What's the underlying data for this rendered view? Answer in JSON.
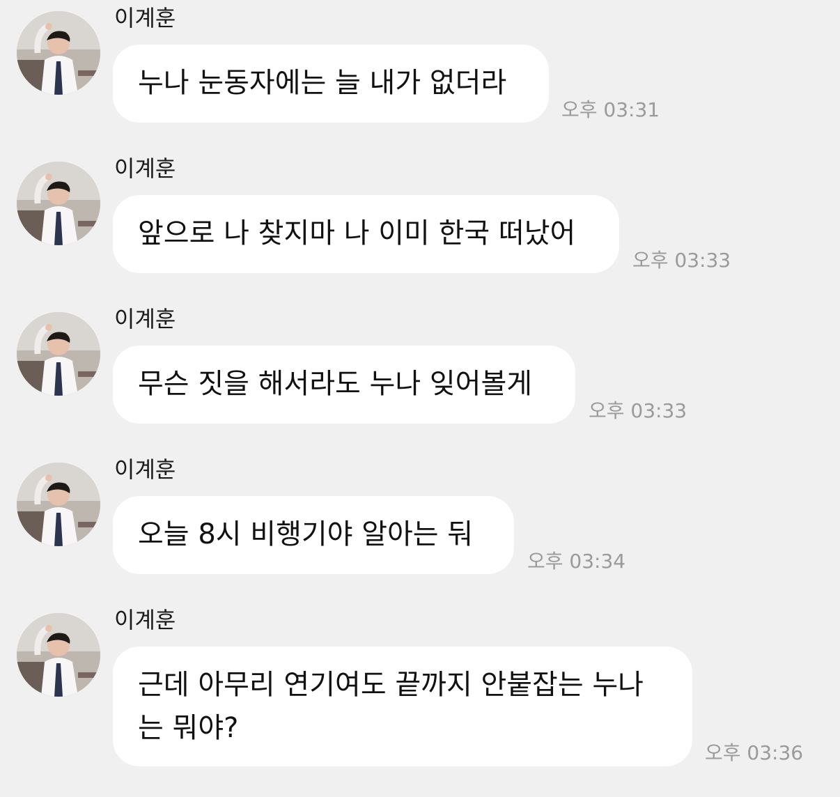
{
  "conversation": {
    "messages": [
      {
        "sender": "이계훈",
        "text": "누나 눈동자에는 늘 내가 없더라",
        "time": "오후 03:31",
        "avatar_icon": "profile-photo"
      },
      {
        "sender": "이계훈",
        "text": "앞으로 나 찾지마 나 이미 한국 떠났어",
        "time": "오후 03:33",
        "avatar_icon": "profile-photo"
      },
      {
        "sender": "이계훈",
        "text": "무슨 짓을 해서라도 누나 잊어볼게",
        "time": "오후 03:33",
        "avatar_icon": "profile-photo"
      },
      {
        "sender": "이계훈",
        "text": "오늘 8시 비행기야 알아는 둬",
        "time": "오후 03:34",
        "avatar_icon": "profile-photo"
      },
      {
        "sender": "이계훈",
        "text": "근데 아무리 연기여도 끝까지 안붙잡는 누나 는 뭐야?",
        "time": "오후 03:36",
        "avatar_icon": "profile-photo"
      }
    ]
  },
  "colors": {
    "background": "#f0f0f0",
    "bubble": "#ffffff",
    "timestamp": "#9a9a9a",
    "text": "#111111"
  }
}
